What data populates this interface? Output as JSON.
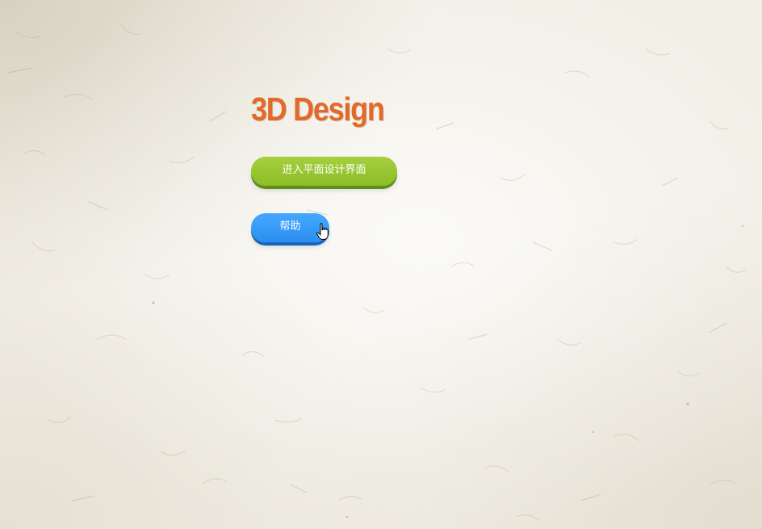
{
  "page": {
    "title": "3D Design"
  },
  "buttons": {
    "enter_label": "进入平面设计界面",
    "help_label": "帮助"
  },
  "colors": {
    "title": "#e0692b",
    "enter_button": "#9ac630",
    "help_button": "#3a9dfa",
    "background": "#f1eee5"
  },
  "icons": {
    "cursor": "hand-pointer-icon"
  }
}
